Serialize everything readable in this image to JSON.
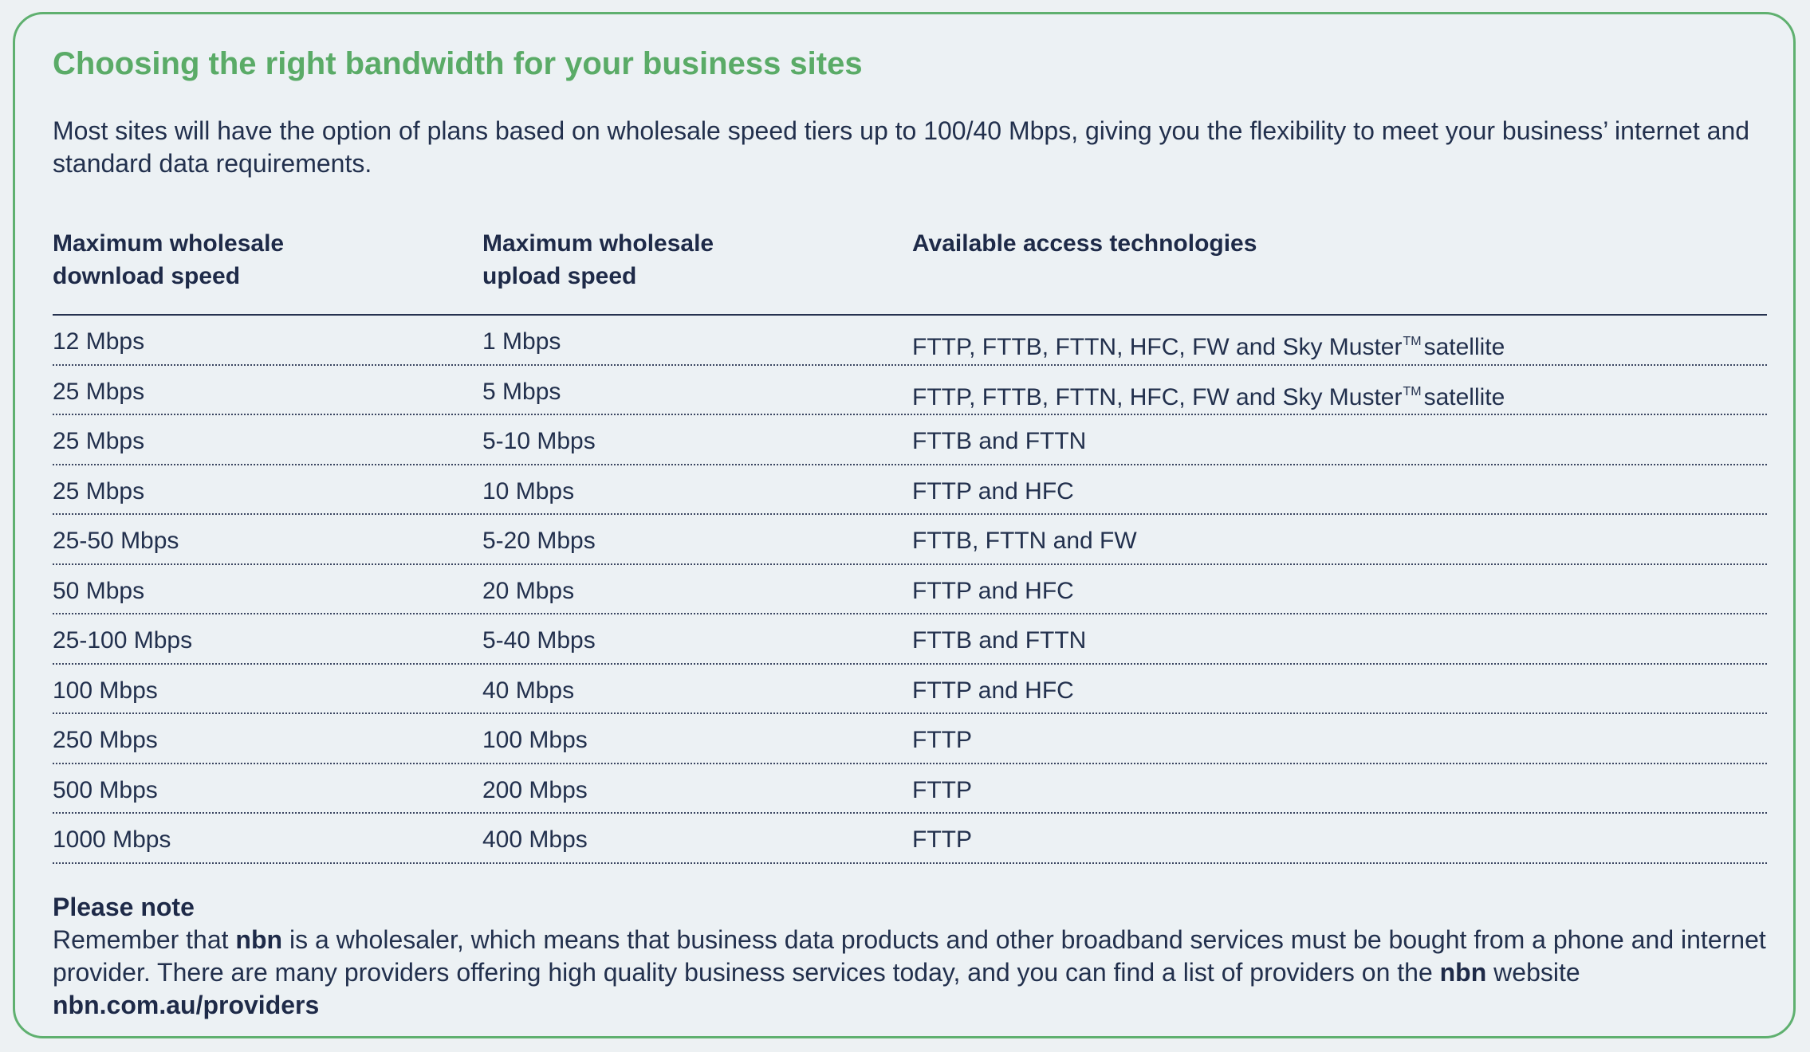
{
  "heading": "Choosing the right bandwidth for your business sites",
  "intro": "Most sites will have the option of plans based on wholesale speed tiers up to 100/40 Mbps, giving you the flexibility to meet your business’ internet and standard data requirements.",
  "table": {
    "headers": {
      "download": "Maximum wholesale\ndownload speed",
      "upload": "Maximum wholesale\nupload speed",
      "technologies": "Available access technologies"
    },
    "trademark": "TM",
    "rows": [
      {
        "download": "12 Mbps",
        "upload": "1 Mbps",
        "tech": "FTTP, FTTB, FTTN, HFC, FW and Sky Muster",
        "tech_suffix": "satellite"
      },
      {
        "download": "25 Mbps",
        "upload": "5 Mbps",
        "tech": "FTTP, FTTB, FTTN, HFC, FW and Sky Muster",
        "tech_suffix": "satellite"
      },
      {
        "download": "25 Mbps",
        "upload": "5-10 Mbps",
        "tech": "FTTB and FTTN"
      },
      {
        "download": "25 Mbps",
        "upload": "10 Mbps",
        "tech": "FTTP and HFC"
      },
      {
        "download": "25-50 Mbps",
        "upload": "5-20 Mbps",
        "tech": "FTTB, FTTN and FW"
      },
      {
        "download": "50 Mbps",
        "upload": "20 Mbps",
        "tech": "FTTP and HFC"
      },
      {
        "download": "25-100 Mbps",
        "upload": "5-40 Mbps",
        "tech": "FTTB and FTTN"
      },
      {
        "download": "100 Mbps",
        "upload": "40 Mbps",
        "tech": "FTTP and HFC"
      },
      {
        "download": "250 Mbps",
        "upload": "100 Mbps",
        "tech": "FTTP"
      },
      {
        "download": "500 Mbps",
        "upload": "200 Mbps",
        "tech": "FTTP"
      },
      {
        "download": "1000 Mbps",
        "upload": "400 Mbps",
        "tech": "FTTP"
      }
    ]
  },
  "note": {
    "heading": "Please note",
    "part1": "Remember that ",
    "brand1": "nbn",
    "part2": " is a wholesaler, which means that business data products and other broadband services must be bought from a phone and internet provider. There are many providers offering high quality business services today, and you can find a list of providers on the ",
    "brand2": "nbn",
    "part3": " website ",
    "link": "nbn.com.au/providers"
  }
}
